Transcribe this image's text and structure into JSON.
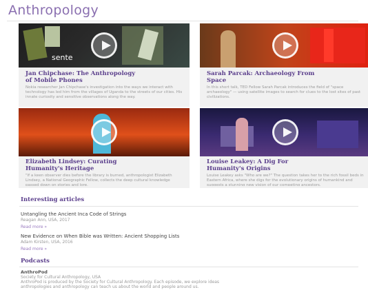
{
  "page": {
    "title": "Anthropology"
  },
  "videos": [
    {
      "thumb_caption": "sente",
      "title_line1": "Jan Chipchase: The Anthropology",
      "title_line2": "of Mobile Phones",
      "desc": "Nokia researcher Jan Chipchase's investigation into the ways we interact with technology has led him from the villages of Uganda to the streets of our cities. His innate curiosity and sensitive observations along the way."
    },
    {
      "thumb_caption": "",
      "title_line1": "Sarah Parcak: Archaeology From",
      "title_line2": "Space",
      "desc": "In this short talk, TED Fellow Sarah Parcak introduces the field of \"space archaeology\" — using satellite images to search for clues to the lost sites of past civilizations."
    },
    {
      "thumb_caption": "",
      "title_line1": "Elizabeth Lindsey: Curating",
      "title_line2": "Humanity's Heritage",
      "desc": "\"If a keen observer dies before the library is burned, anthropologist Elizabeth Lindsey, a National Geographic Fellow, collects the deep cultural knowledge passed down on stories and lore."
    },
    {
      "thumb_caption": "",
      "title_line1": "Louise Leakey: A Dig For",
      "title_line2": "Humanity's Origins",
      "desc": "Louise Leakey asks \"Who are we?\" The question takes her to the rich fossil beds in Eastern Africa, where she digs for the evolutionary origins of humankind and suggests a stunning new vision of our competing ancestors."
    }
  ],
  "articles": {
    "heading": "Interesting articles",
    "items": [
      {
        "title": "Untangling the Ancient Inca Code of Strings",
        "meta": "Reagan Ann, USA, 2017",
        "read_more": "Read more »"
      },
      {
        "title": "New Evidence on When Bible was Written: Ancient Shopping Lists",
        "meta": "Adam Kirsten, USA, 2016",
        "read_more": "Read more »"
      }
    ]
  },
  "podcasts": {
    "heading": "Podcasts",
    "title": "AnthroPod",
    "meta": "Society for Cultural Anthropology, USA",
    "desc1": "AnthroPod is produced by the Society for Cultural Anthropology. Each episode, we explore ideas",
    "desc2": "anthropologies and anthropology can teach us about the world and people around us."
  },
  "colors": {
    "accent": "#5b3f8c",
    "title": "#8a6fb0"
  }
}
